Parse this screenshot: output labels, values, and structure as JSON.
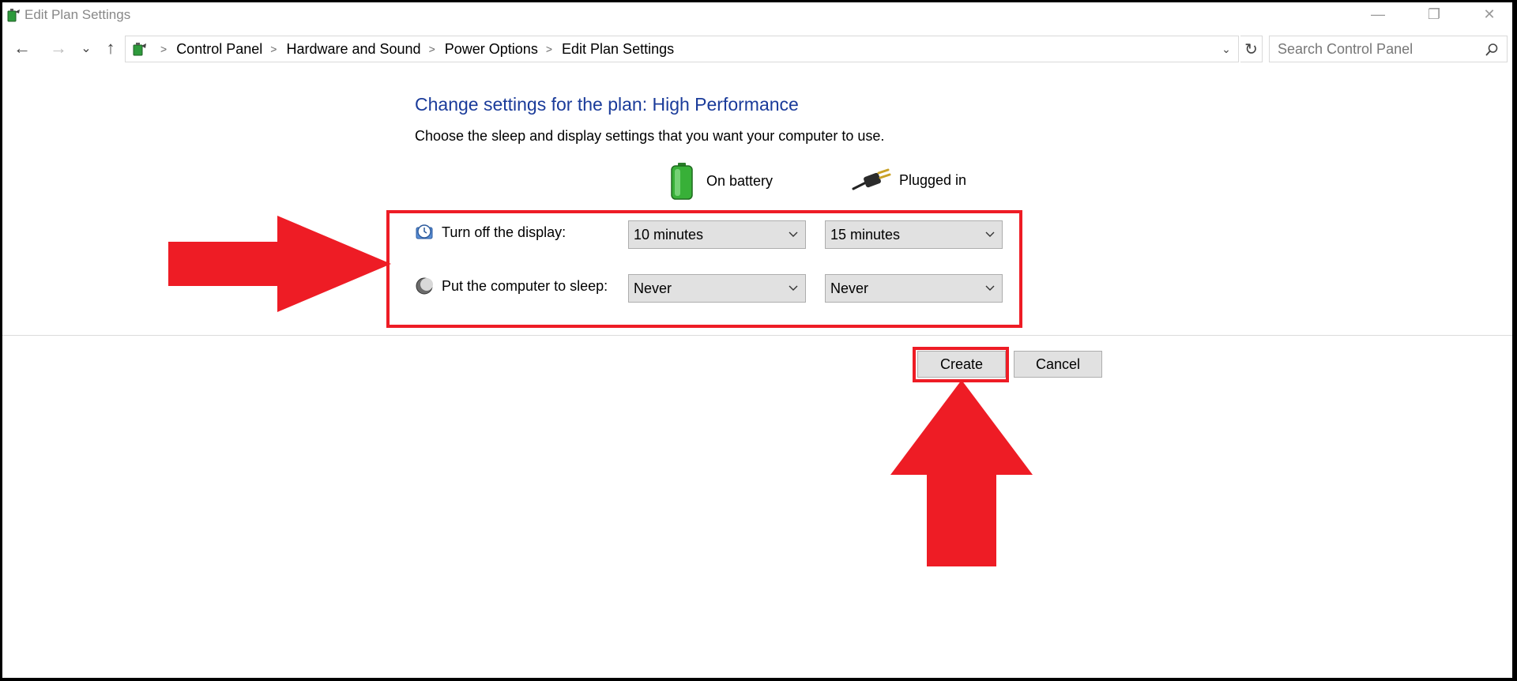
{
  "window": {
    "title": "Edit Plan Settings",
    "minimize_glyph": "—",
    "restore_glyph": "❐",
    "close_glyph": "✕"
  },
  "nav": {
    "back_glyph": "←",
    "forward_glyph": "→",
    "recent_glyph": "⌄",
    "up_glyph": "↑",
    "breadcrumb": [
      "Control Panel",
      "Hardware and Sound",
      "Power Options",
      "Edit Plan Settings"
    ],
    "refresh_glyph": "↻",
    "dropdown_glyph": "⌄"
  },
  "search": {
    "placeholder": "Search Control Panel"
  },
  "main": {
    "heading": "Change settings for the plan: High Performance",
    "subtext": "Choose the sleep and display settings that you want your computer to use.",
    "columns": {
      "battery": "On battery",
      "plugged": "Plugged in"
    },
    "rows": [
      {
        "label": "Turn off the display:",
        "battery_value": "10 minutes",
        "plugged_value": "15 minutes"
      },
      {
        "label": "Put the computer to sleep:",
        "battery_value": "Never",
        "plugged_value": "Never"
      }
    ]
  },
  "buttons": {
    "create": "Create",
    "cancel": "Cancel"
  },
  "annotation": {
    "color": "#ee1c25"
  },
  "colors": {
    "heading": "#1a3b9a"
  }
}
